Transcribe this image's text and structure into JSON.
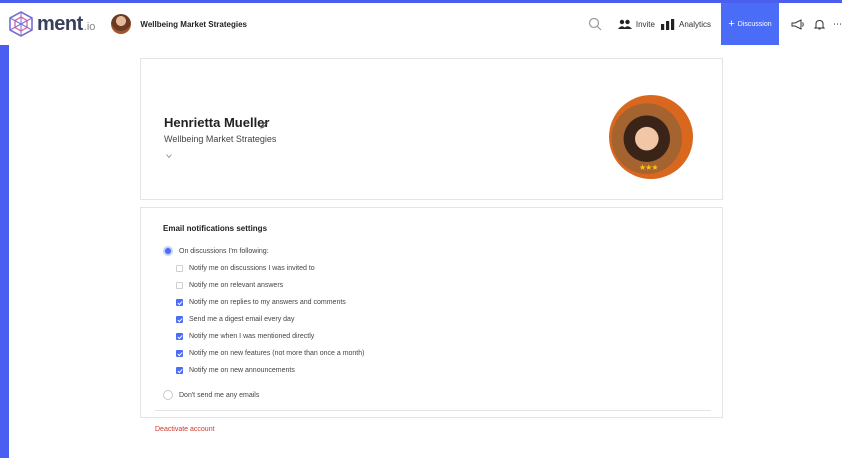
{
  "header": {
    "logo_text": "ment",
    "logo_suffix": ".io",
    "org_name": "Wellbeing Market Strategies",
    "nav": {
      "invite_label": "Invite",
      "analytics_label": "Analytics",
      "discussion_label": "Discussion"
    },
    "icons": {
      "search": "search-icon",
      "invite": "people-icon",
      "analytics": "bar-chart-icon",
      "announcements": "megaphone-icon",
      "notifications": "bell-icon"
    }
  },
  "profile": {
    "name": "Henrietta Mueller",
    "organization": "Wellbeing Market Strategies",
    "stars": "★★★"
  },
  "email_settings": {
    "title": "Email notifications settings",
    "following_option": "On discussions I'm following:",
    "following_selected": true,
    "options": [
      {
        "label": "Notify me on discussions I was invited to",
        "checked": false
      },
      {
        "label": "Notify me on relevant answers",
        "checked": false
      },
      {
        "label": "Notify me on replies to my answers and comments",
        "checked": true
      },
      {
        "label": "Send me a digest email every day",
        "checked": true
      },
      {
        "label": "Notify me when I was mentioned directly",
        "checked": true
      },
      {
        "label": "Notify me on new features (not more than once a month)",
        "checked": true
      },
      {
        "label": "Notify me on new announcements",
        "checked": true
      }
    ],
    "no_email_option": "Don't send me any emails",
    "no_email_selected": false
  },
  "deactivate_label": "Deactivate account",
  "colors": {
    "accent": "#4a6cf7",
    "frame": "#4a5ef0",
    "danger": "#d03a2f"
  }
}
